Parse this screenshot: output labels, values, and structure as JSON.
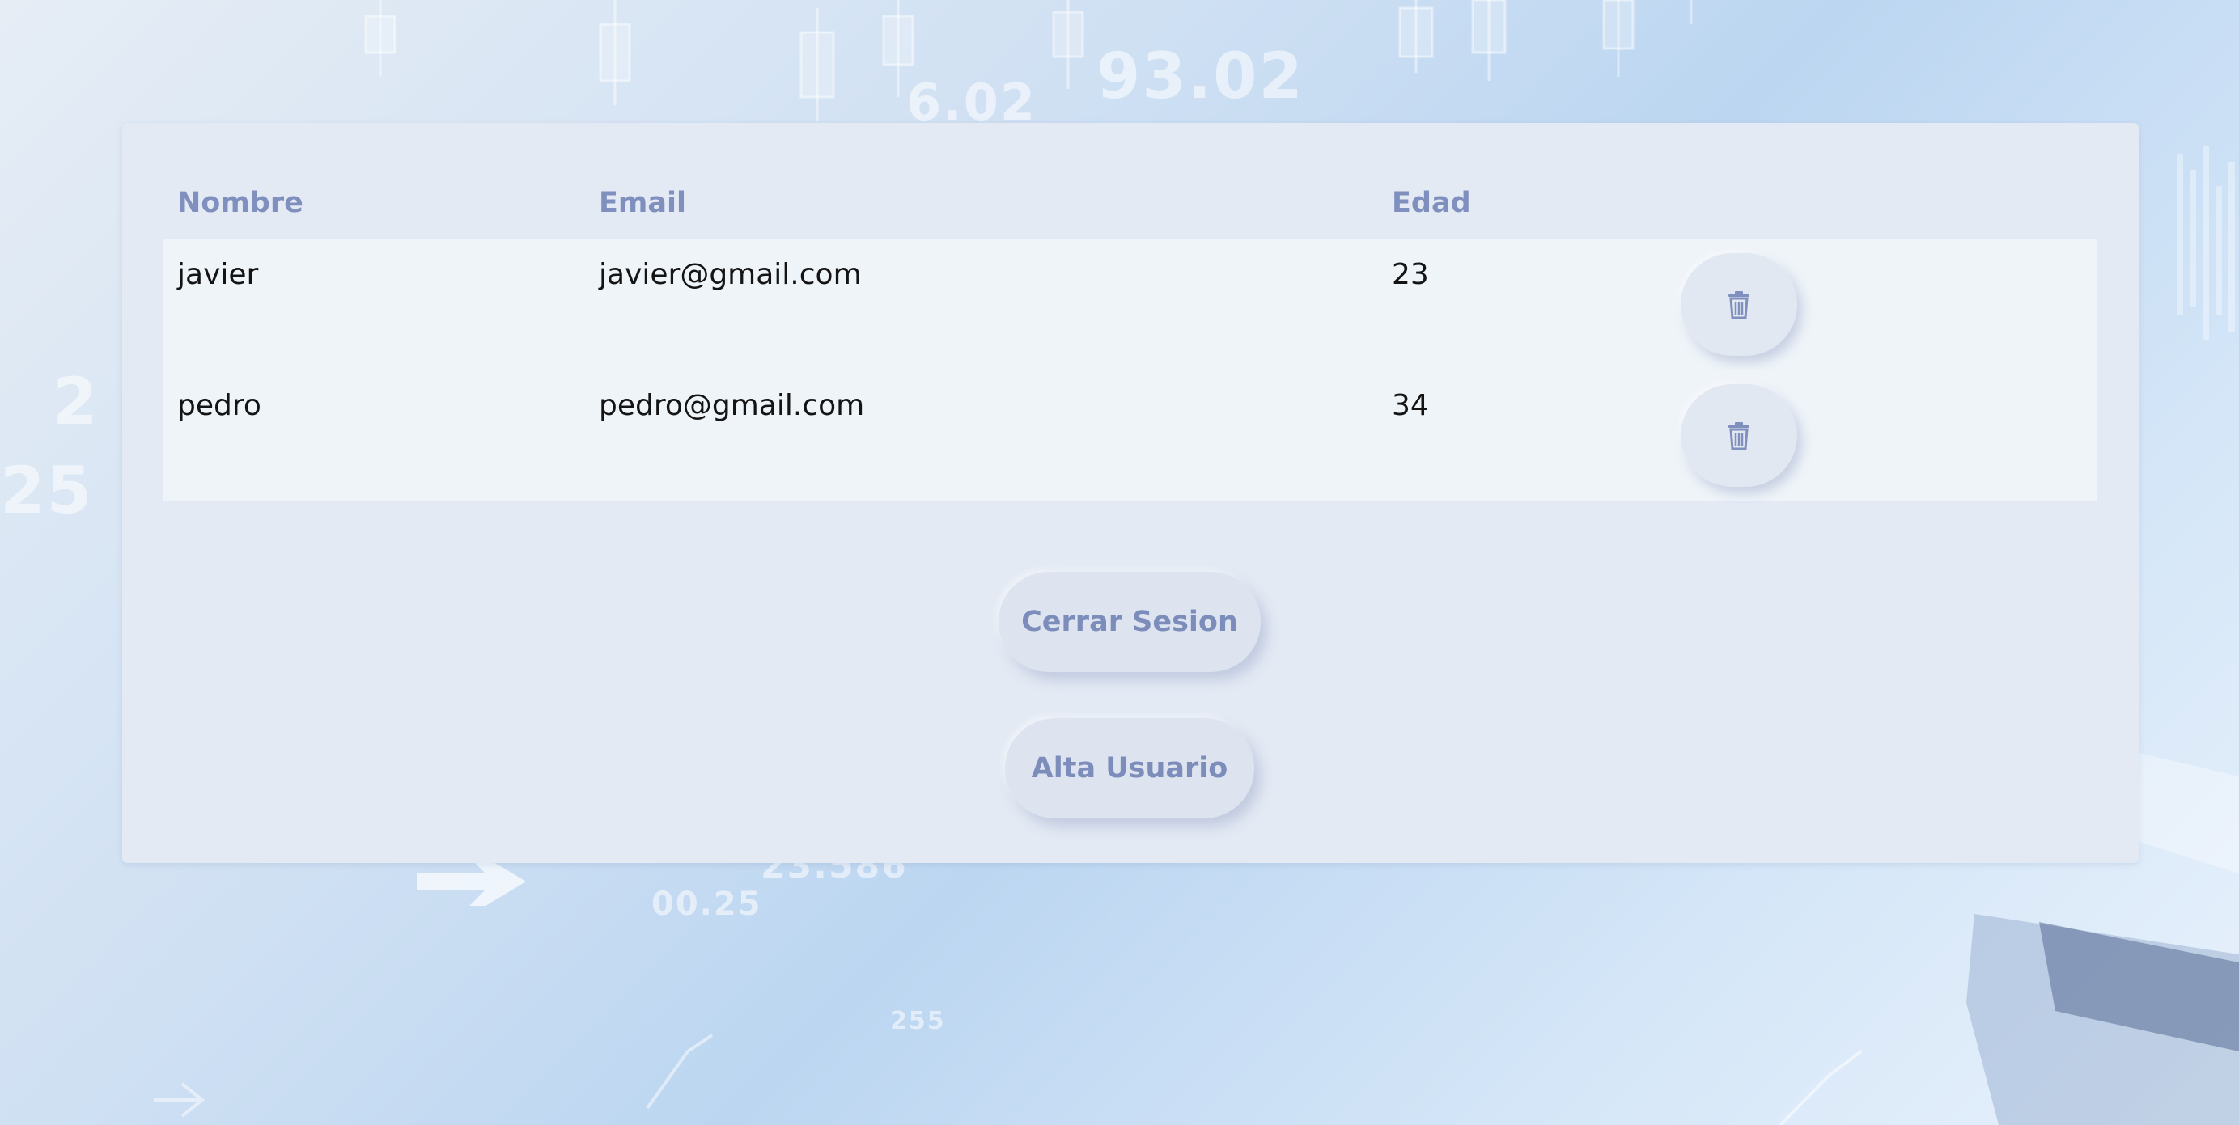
{
  "table": {
    "headers": [
      "Nombre",
      "Email",
      "Edad"
    ],
    "rows": [
      {
        "nombre": "javier",
        "email": "javier@gmail.com",
        "edad": "23"
      },
      {
        "nombre": "pedro",
        "email": "pedro@gmail.com",
        "edad": "34"
      }
    ]
  },
  "actions": {
    "logout_label": "Cerrar Sesion",
    "add_user_label": "Alta Usuario"
  },
  "background": {
    "numbers": [
      "93.02",
      "6.02",
      "2",
      "25",
      "23.586",
      "00.25",
      "255"
    ]
  },
  "icons": {
    "row_delete": "trash-icon"
  },
  "colors": {
    "accent_text": "#7f8fbe",
    "panel": "#e4eaf4",
    "row": "#eff4f9"
  }
}
